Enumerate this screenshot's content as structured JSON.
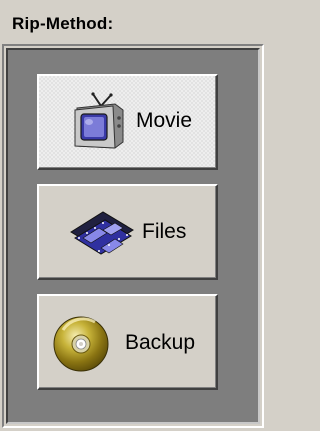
{
  "rip_method": {
    "heading": "Rip-Method:",
    "selected": "movie",
    "buttons": [
      {
        "id": "movie",
        "label": "Movie",
        "icon": "tv-icon"
      },
      {
        "id": "files",
        "label": "Files",
        "icon": "film-strip-icon"
      },
      {
        "id": "backup",
        "label": "Backup",
        "icon": "disc-icon"
      }
    ]
  }
}
